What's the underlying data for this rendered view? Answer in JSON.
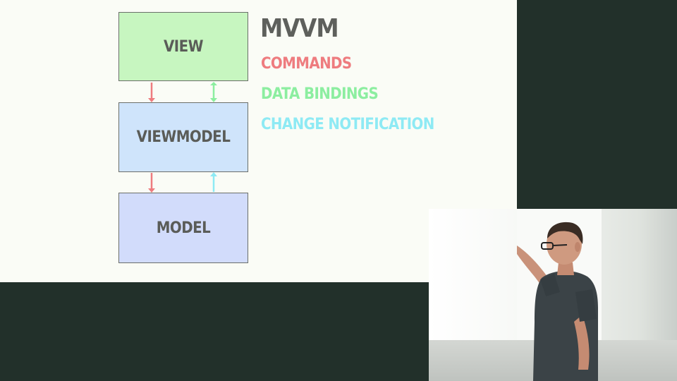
{
  "diagram": {
    "boxes": {
      "view": {
        "label": "VIEW",
        "color": "#c7f6c0"
      },
      "viewmodel": {
        "label": "VIEWMODEL",
        "color": "#cfe4fb"
      },
      "model": {
        "label": "MODEL",
        "color": "#d2dcfb"
      }
    },
    "legend": {
      "title": "MVVM",
      "commands": {
        "label": "COMMANDS",
        "color": "#ee7c7f"
      },
      "data_bindings": {
        "label": "DATA BINDINGS",
        "color": "#8ceea0"
      },
      "change_notification": {
        "label": "CHANGE NOTIFICATION",
        "color": "#8eeaf4"
      }
    }
  },
  "colors": {
    "slide_background": "#fafcf6",
    "frame_background": "#22302a",
    "box_text": "#5a5c58",
    "title_text": "#5e605c"
  }
}
